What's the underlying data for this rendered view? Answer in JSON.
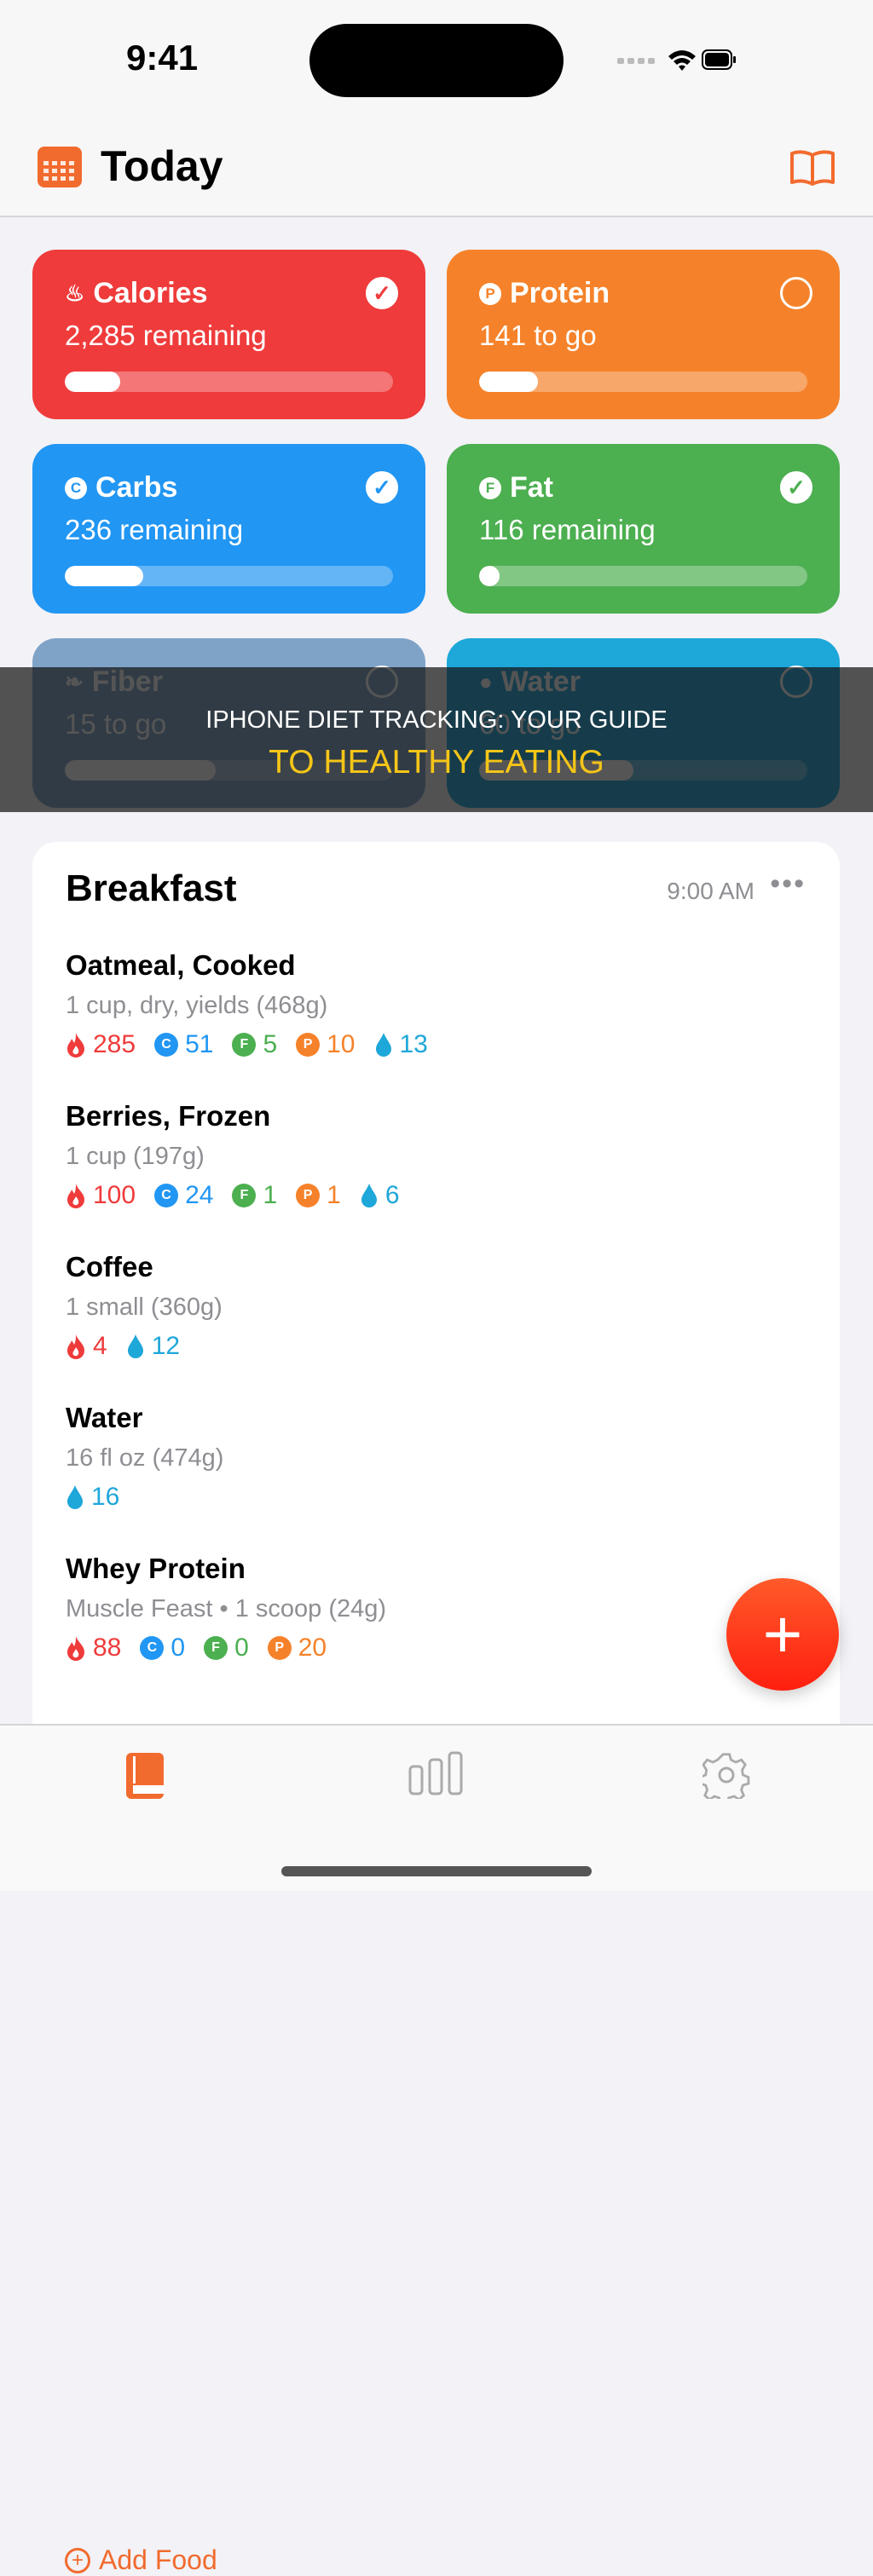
{
  "status": {
    "time": "9:41"
  },
  "header": {
    "title": "Today"
  },
  "colors": {
    "accent": "#f26b2e",
    "calories": "#ef3b3b",
    "protein": "#f5822a",
    "carbs": "#2196f3",
    "fat": "#4caf50",
    "fiber": "#7fa3c7",
    "water": "#1ea7d9",
    "banner_highlight": "#f5c518"
  },
  "cards": [
    {
      "title": "Calories",
      "subtitle": "2,285 remaining",
      "icon": "flame-icon",
      "glyph": "🔥",
      "checked": true,
      "progress": 0.17,
      "color": "#ef3b3b"
    },
    {
      "title": "Protein",
      "subtitle": "141 to go",
      "icon": "protein-icon",
      "glyph": "P",
      "checked": false,
      "progress": 0.18,
      "color": "#f5822a"
    },
    {
      "title": "Carbs",
      "subtitle": "236 remaining",
      "icon": "carbs-icon",
      "glyph": "C",
      "checked": true,
      "progress": 0.24,
      "color": "#2196f3"
    },
    {
      "title": "Fat",
      "subtitle": "116 remaining",
      "icon": "fat-icon",
      "glyph": "F",
      "checked": true,
      "progress": 0.04,
      "color": "#4caf50"
    },
    {
      "title": "Fiber",
      "subtitle": "15 to go",
      "icon": "leaf-icon",
      "glyph": "❧",
      "checked": false,
      "progress": 0.46,
      "color": "#7fa3c7"
    },
    {
      "title": "Water",
      "subtitle": "60 to go",
      "icon": "water-drop-icon",
      "glyph": "💧",
      "checked": false,
      "progress": 0.47,
      "color": "#1ea7d9"
    }
  ],
  "banner": {
    "line1": "IPHONE DIET TRACKING: YOUR GUIDE",
    "line2": "TO HEALTHY EATING"
  },
  "meal": {
    "title": "Breakfast",
    "time": "9:00 AM",
    "more": "•••",
    "items": [
      {
        "name": "Oatmeal, Cooked",
        "serving": "1 cup, dry, yields (468g)",
        "macros": [
          {
            "k": "cal",
            "v": "285"
          },
          {
            "k": "c",
            "v": "51"
          },
          {
            "k": "f",
            "v": "5"
          },
          {
            "k": "p",
            "v": "10"
          },
          {
            "k": "w",
            "v": "13"
          }
        ]
      },
      {
        "name": "Berries, Frozen",
        "serving": "1 cup (197g)",
        "macros": [
          {
            "k": "cal",
            "v": "100"
          },
          {
            "k": "c",
            "v": "24"
          },
          {
            "k": "f",
            "v": "1"
          },
          {
            "k": "p",
            "v": "1"
          },
          {
            "k": "w",
            "v": "6"
          }
        ]
      },
      {
        "name": "Coffee",
        "serving": "1 small (360g)",
        "macros": [
          {
            "k": "cal",
            "v": "4"
          },
          {
            "k": "w",
            "v": "12"
          }
        ]
      },
      {
        "name": "Water",
        "serving": "16 fl oz (474g)",
        "macros": [
          {
            "k": "w",
            "v": "16"
          }
        ]
      },
      {
        "name": "Whey Protein",
        "serving": "Muscle Feast • 1 scoop (24g)",
        "macros": [
          {
            "k": "cal",
            "v": "88"
          },
          {
            "k": "c",
            "v": "0"
          },
          {
            "k": "f",
            "v": "0"
          },
          {
            "k": "p",
            "v": "20"
          }
        ]
      }
    ],
    "add_food": "Add Food"
  },
  "tabs": [
    {
      "name": "diary",
      "icon": "book-icon",
      "active": true
    },
    {
      "name": "stats",
      "icon": "bar-chart-icon",
      "active": false
    },
    {
      "name": "settings",
      "icon": "gear-icon",
      "active": false
    }
  ]
}
